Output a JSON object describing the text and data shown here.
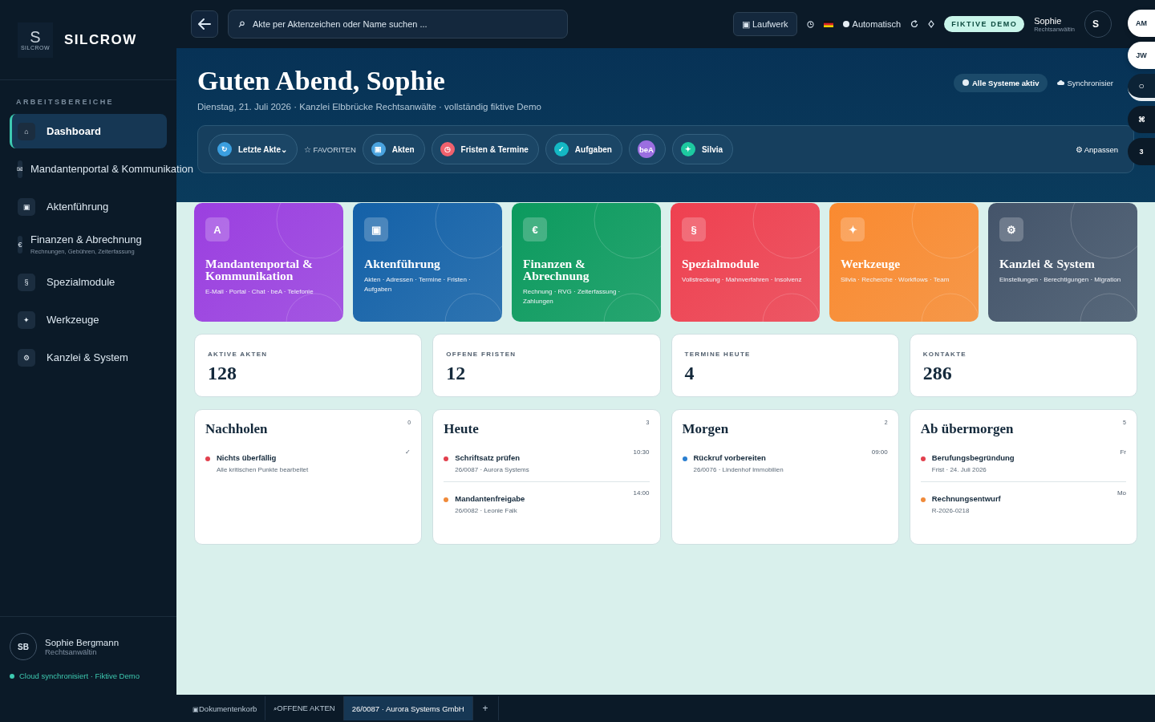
{
  "sidebar": {
    "logo_mark": "S",
    "logo_caption": "SILCROW",
    "brand": "SILCROW",
    "section": "ARBEITSBEREICHE",
    "items": [
      {
        "icon": "⌂",
        "label": "Dashboard",
        "selected": true
      },
      {
        "icon": "✉",
        "label": "Mandantenportal & Kommunikation",
        "selected": false,
        "kind": "narrow"
      },
      {
        "icon": "▣",
        "label": "Aktenführung",
        "selected": false
      },
      {
        "icon": "€",
        "label": "Finanzen & Abrechnung",
        "sub": "Rechnungen, Gebühren, Zeiterfassung",
        "selected": false,
        "kind": "narrow"
      },
      {
        "icon": "§",
        "label": "Spezialmodule",
        "selected": false
      },
      {
        "icon": "✦",
        "label": "Werkzeuge",
        "selected": false
      },
      {
        "icon": "⚙",
        "label": "Kanzlei & System",
        "selected": false
      }
    ],
    "user": {
      "initials": "SB",
      "name": "Sophie Bergmann",
      "role": "Rechtsanwältin"
    },
    "sync": "Cloud synchronisiert · Fiktive Demo"
  },
  "topbar": {
    "search_placeholder": "Akte per Aktenzeichen oder Name suchen ...",
    "drive": {
      "icon": "▣",
      "label": "Laufwerk"
    },
    "mode": "Automatisch",
    "badge": "FIKTIVE DEMO",
    "user_name": "Sophie",
    "user_role": "Rechtsanwältin",
    "avatar": "S"
  },
  "hero": {
    "title": "Guten Abend, Sophie",
    "subtitle": "Dienstag, 21. Juli 2026 · Kanzlei Elbbrücke Rechtsanwälte · vollständig fiktive Demo",
    "status": "Alle Systeme aktiv",
    "sync": "Synchronisier",
    "quick": [
      {
        "kind": "chip",
        "icon": "↻",
        "label": "Letzte Akte⌄",
        "color": "#3b9fe0"
      },
      {
        "kind": "label",
        "label": "☆ FAVORITEN"
      },
      {
        "kind": "chip",
        "icon": "▣",
        "label": "Akten",
        "color": "#4aa3df"
      },
      {
        "kind": "chip",
        "icon": "◷",
        "label": "Fristen & Termine",
        "color": "#f0616d"
      },
      {
        "kind": "chip",
        "icon": "✓",
        "label": "Aufgaben",
        "color": "#14b8c4"
      },
      {
        "kind": "chip",
        "icon": "beA",
        "color": "#9b6ee0"
      },
      {
        "kind": "chip",
        "icon": "✦",
        "label": "Silvia",
        "color": "#1dc9a0"
      }
    ],
    "customize": "⚙ Anpassen"
  },
  "modules": [
    {
      "icon": "A",
      "title": "Mandantenportal & Kommunikation",
      "subtitle": "E-Mail · Portal · Chat · beA · Telefonie",
      "color": "#9b3fe0"
    },
    {
      "icon": "▣",
      "title": "Aktenführung",
      "subtitle": "Akten · Adressen · Termine · Fristen · Aufgaben",
      "color": "#1461a8"
    },
    {
      "icon": "€",
      "title": "Finanzen & Abrechnung",
      "subtitle": "Rechnung · RVG · Zeiterfassung · Zahlungen",
      "color": "#0c9a5e"
    },
    {
      "icon": "§",
      "title": "Spezialmodule",
      "subtitle": "Vollstreckung · Mahnverfahren · Insolvenz",
      "color": "#ef4050"
    },
    {
      "icon": "✦",
      "title": "Werkzeuge",
      "subtitle": "Silvia · Recherche · Workflows · Team",
      "color": "#fa8a30"
    },
    {
      "icon": "⚙",
      "title": "Kanzlei & System",
      "subtitle": "Einstellungen · Berechtigungen · Migration",
      "color": "#44546a"
    }
  ],
  "stats": [
    {
      "label": "AKTIVE AKTEN",
      "value": "128"
    },
    {
      "label": "OFFENE FRISTEN",
      "value": "12"
    },
    {
      "label": "TERMINE HEUTE",
      "value": "4"
    },
    {
      "label": "KONTAKTE",
      "value": "286"
    }
  ],
  "agenda": [
    {
      "title": "Nachholen",
      "count": "0",
      "items": [
        {
          "title": "Nichts überfällig",
          "meta": "Alle kritischen Punkte bearbeitet",
          "aside": "✓",
          "color": "#e2404e"
        }
      ]
    },
    {
      "title": "Heute",
      "count": "3",
      "items": [
        {
          "title": "Schriftsatz prüfen",
          "meta": "26/0087 · Aurora Systems",
          "aside": "10:30",
          "color": "#e2404e"
        },
        {
          "title": "Mandantenfreigabe",
          "meta": "26/0082 · Leonie Falk",
          "aside": "14:00",
          "color": "#f08a3a"
        }
      ]
    },
    {
      "title": "Morgen",
      "count": "2",
      "items": [
        {
          "title": "Rückruf vorbereiten",
          "meta": "26/0076 · Lindenhof Immobilien",
          "aside": "09:00",
          "color": "#2a7fd0"
        }
      ]
    },
    {
      "title": "Ab übermorgen",
      "count": "5",
      "items": [
        {
          "title": "Berufungsbegründung",
          "meta": "Frist · 24. Juli 2026",
          "aside": "Fr",
          "color": "#e2404e"
        },
        {
          "title": "Rechnungsentwurf",
          "meta": "R-2026-0218",
          "aside": "Mo",
          "color": "#f08a3a"
        }
      ]
    }
  ],
  "float_pills": [
    {
      "text": "AM",
      "kind": "light"
    },
    {
      "text": "JW",
      "kind": "light"
    },
    {
      "text": "○",
      "kind": "ring"
    },
    {
      "text": "⌘",
      "kind": "dark"
    },
    {
      "text": "3",
      "kind": "dark"
    }
  ],
  "bottom_tabs": [
    {
      "icon": "▣",
      "label": "Dokumentenkorb",
      "selected": false
    },
    {
      "icon": "⌕",
      "label": "OFFENE AKTEN",
      "selected": false
    },
    {
      "label": "26/0087 · Aurora Systems GmbH",
      "selected": true
    }
  ],
  "add_tab": "+"
}
